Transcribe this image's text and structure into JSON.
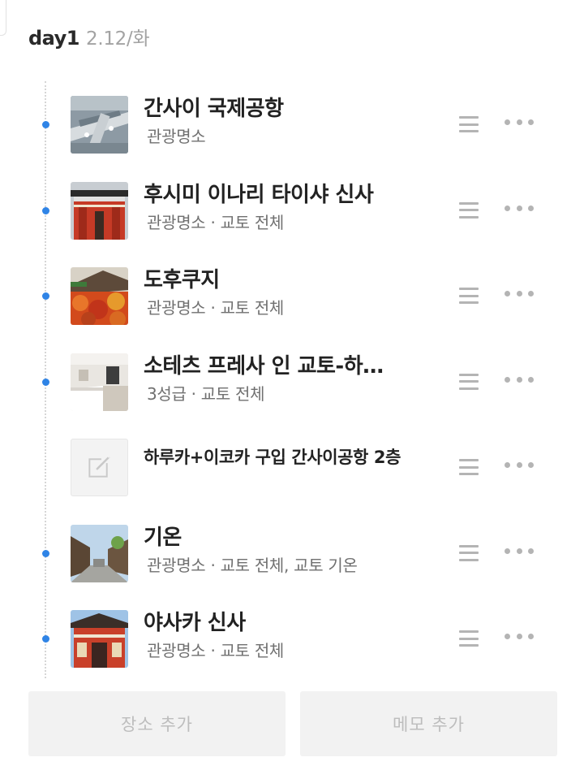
{
  "day": {
    "label": "day1",
    "date": "2.12/화"
  },
  "items": [
    {
      "type": "place",
      "title": "간사이 국제공항",
      "subtitle": "관광명소",
      "icon": "airport-photo"
    },
    {
      "type": "place",
      "title": "후시미 이나리 타이샤 신사",
      "subtitle": "관광명소 · 교토 전체",
      "icon": "shrine-gate-photo"
    },
    {
      "type": "place",
      "title": "도후쿠지",
      "subtitle": "관광명소 · 교토 전체",
      "icon": "autumn-temple-photo"
    },
    {
      "type": "place",
      "title": "소테츠 프레사 인 교토-하…",
      "subtitle": "3성급 · 교토 전체",
      "icon": "hotel-room-photo"
    },
    {
      "type": "memo",
      "title": "하루카+이코카 구입 간사이공항 2층",
      "icon": "memo-edit-icon"
    },
    {
      "type": "place",
      "title": "기온",
      "subtitle": "관광명소 · 교토 전체, 교토 기온",
      "icon": "street-photo"
    },
    {
      "type": "place",
      "title": "야사카 신사",
      "subtitle": "관광명소 · 교토 전체",
      "icon": "red-shrine-photo"
    }
  ],
  "buttons": {
    "add_place": "장소 추가",
    "add_memo": "메모 추가"
  },
  "colors": {
    "timeline_dot": "#2f84e6",
    "handle": "#b4b4b4",
    "button_bg": "#f2f2f2",
    "button_text": "#bdbdbd"
  }
}
